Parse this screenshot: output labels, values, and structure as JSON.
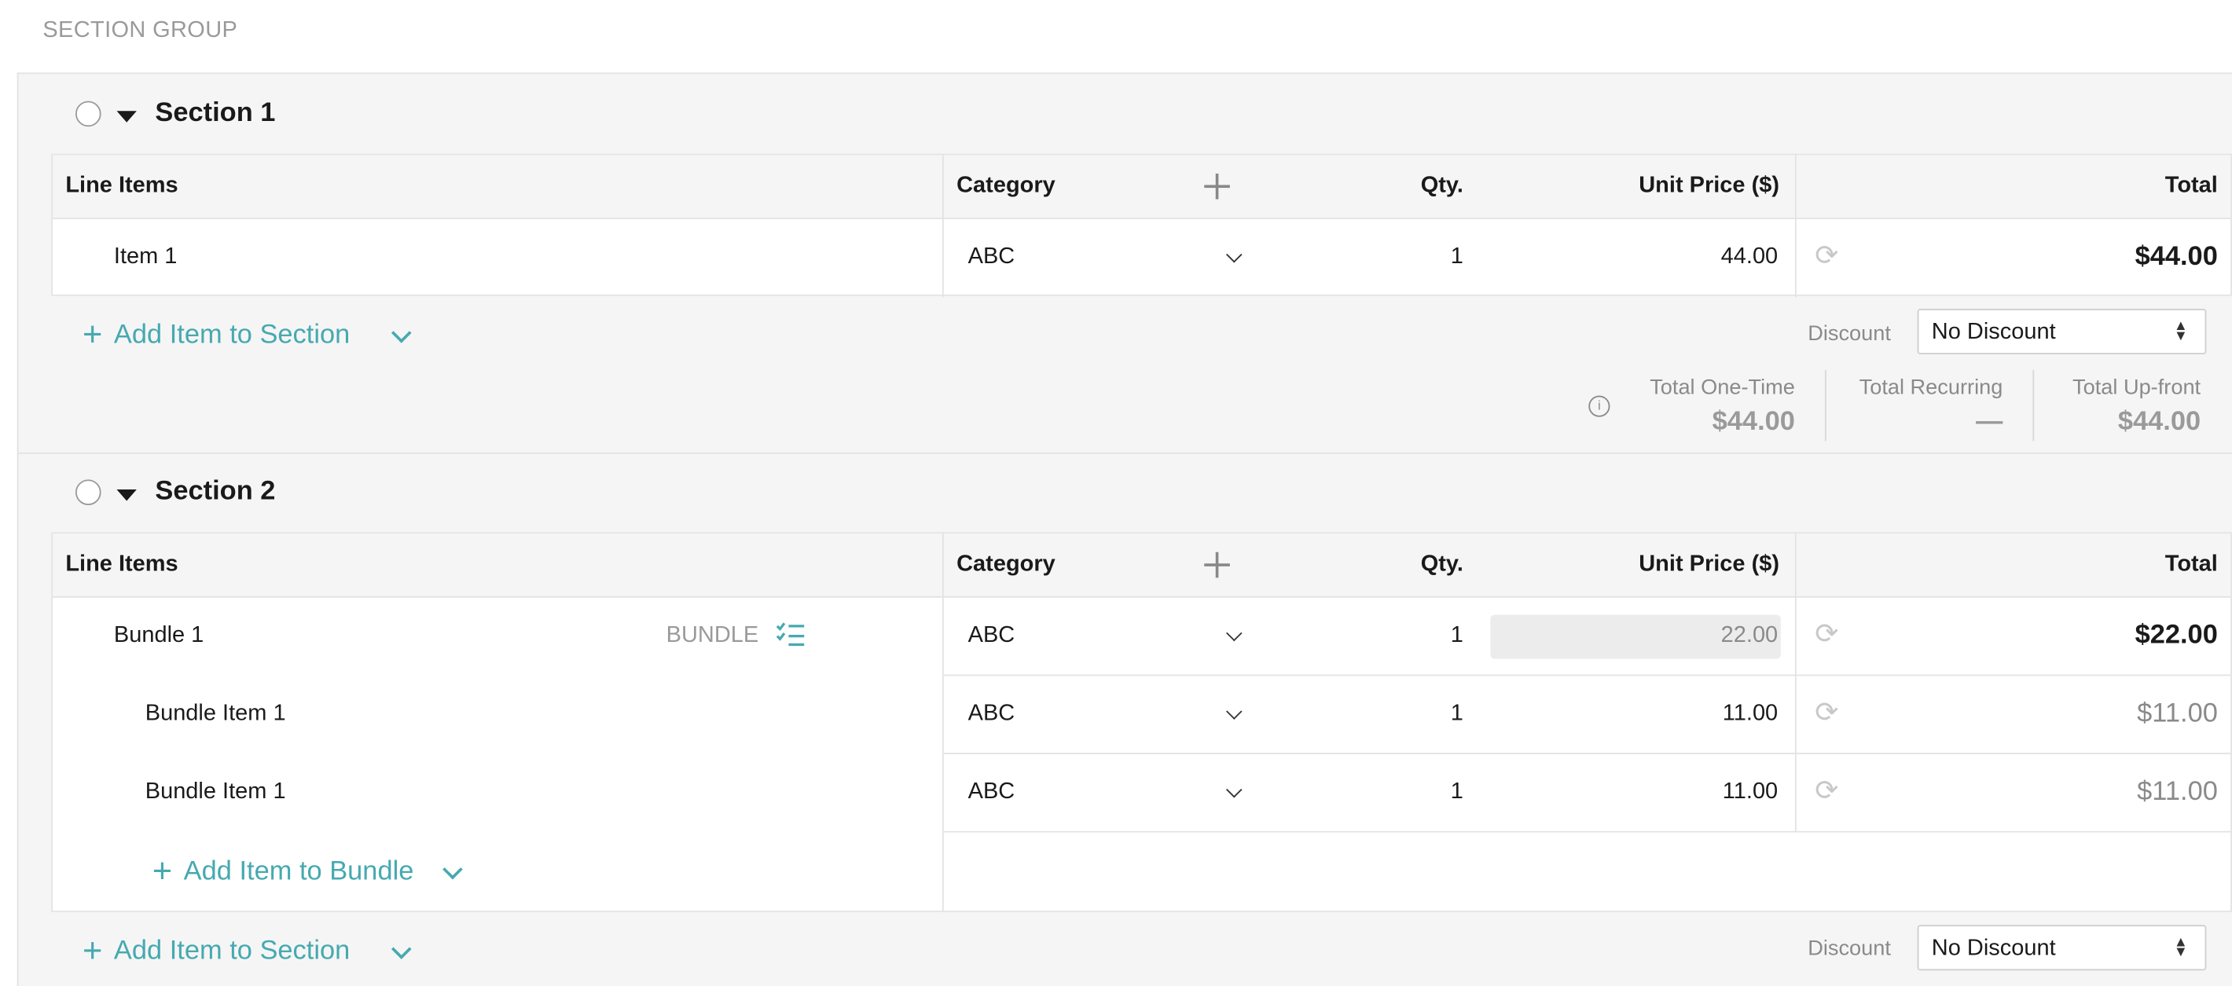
{
  "group_title": "SECTION GROUP",
  "columns": {
    "line_items": "Line Items",
    "category": "Category",
    "qty": "Qty.",
    "unit_price": "Unit Price ($)",
    "total": "Total"
  },
  "sections": [
    {
      "title": "Section 1",
      "rows": [
        {
          "name": "Item 1",
          "category": "ABC",
          "qty": "1",
          "unit_price": "44.00",
          "total": "$44.00"
        }
      ],
      "add_item_label": "Add Item to Section",
      "discount_label": "Discount",
      "discount_value": "No Discount",
      "totals": [
        {
          "label": "Total One-Time",
          "value": "$44.00"
        },
        {
          "label": "Total Recurring",
          "value": "—"
        },
        {
          "label": "Total Up-front",
          "value": "$44.00"
        }
      ]
    },
    {
      "title": "Section 2",
      "rows": [
        {
          "name": "Bundle 1",
          "tag": "BUNDLE",
          "category": "ABC",
          "qty": "1",
          "unit_price": "22.00",
          "total": "$22.00"
        },
        {
          "name": "Bundle Item 1",
          "category": "ABC",
          "qty": "1",
          "unit_price": "11.00",
          "total": "$11.00"
        },
        {
          "name": "Bundle Item 1",
          "category": "ABC",
          "qty": "1",
          "unit_price": "11.00",
          "total": "$11.00"
        }
      ],
      "add_bundle_label": "Add Item to Bundle",
      "add_item_label": "Add Item to Section",
      "discount_label": "Discount",
      "discount_value": "No Discount"
    }
  ],
  "colors": {
    "accent": "#46a9b0",
    "background": "#f5f5f5",
    "border": "#e3e3e3"
  }
}
